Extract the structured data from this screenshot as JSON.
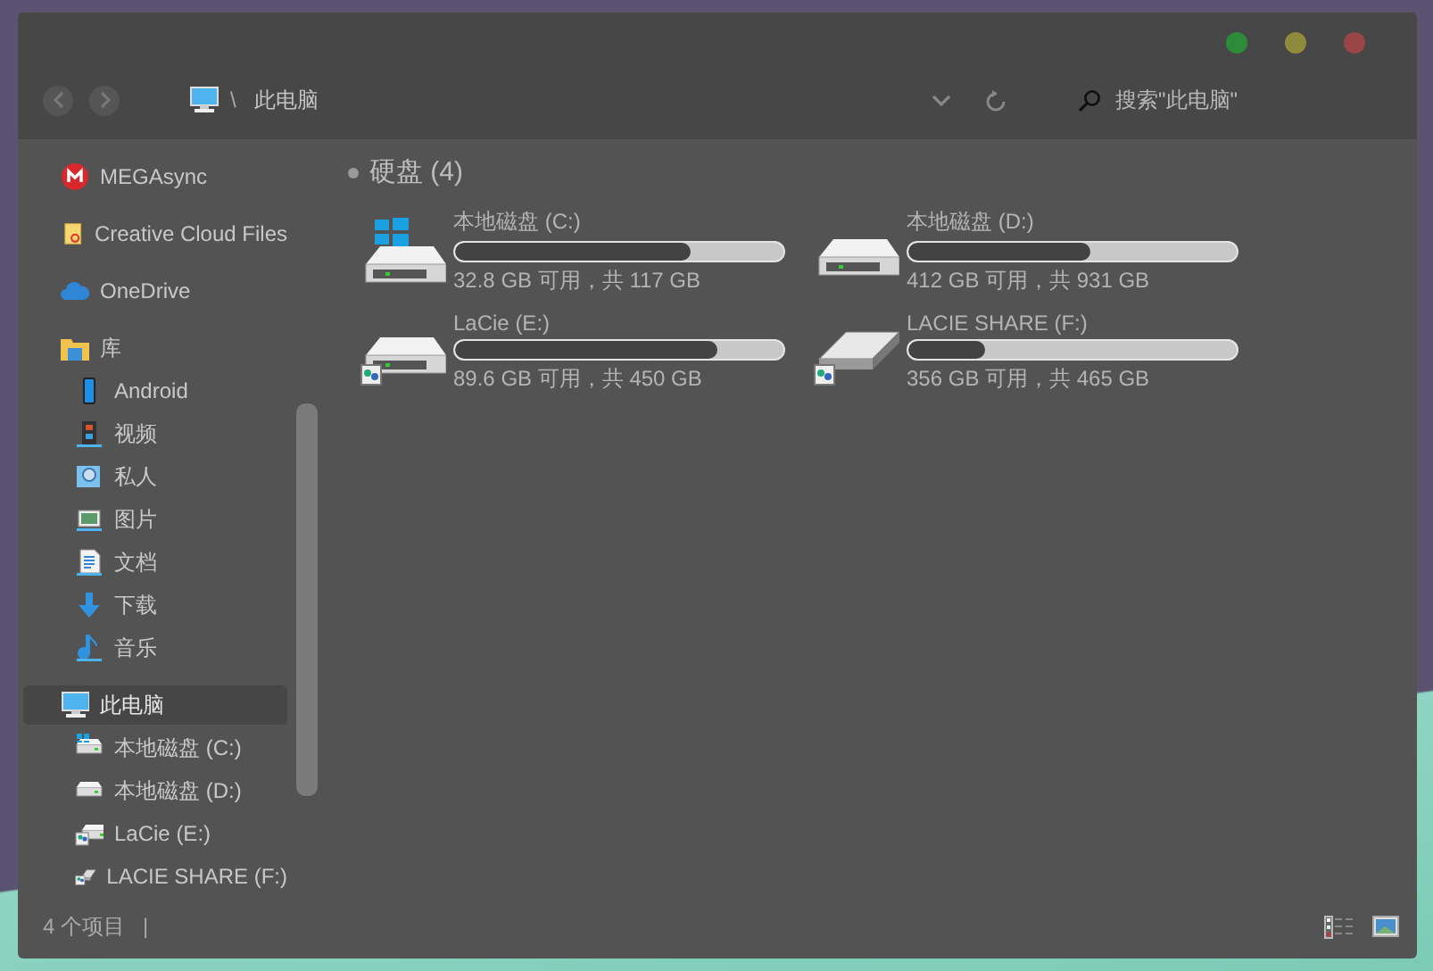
{
  "window": {
    "title_buttons": [
      {
        "color": "#2e8b3a"
      },
      {
        "color": "#8f8a3c"
      },
      {
        "color": "#9a4646"
      }
    ]
  },
  "address_bar": {
    "path": "此电脑",
    "separator": "\\"
  },
  "search": {
    "placeholder": "搜索\"此电脑\""
  },
  "sidebar": {
    "items": [
      {
        "label": "MEGAsync",
        "selected": false
      },
      {
        "label": "Creative Cloud Files",
        "selected": false
      },
      {
        "label": "OneDrive",
        "selected": false
      },
      {
        "label": "库",
        "selected": false,
        "children": [
          {
            "label": "Android",
            "selected": false
          },
          {
            "label": "视频",
            "selected": false
          },
          {
            "label": "私人",
            "selected": false
          },
          {
            "label": "图片",
            "selected": false
          },
          {
            "label": "文档",
            "selected": false
          },
          {
            "label": "下载",
            "selected": false
          },
          {
            "label": "音乐",
            "selected": false
          }
        ]
      },
      {
        "label": "此电脑",
        "selected": true,
        "children": [
          {
            "label": "本地磁盘 (C:)",
            "selected": false
          },
          {
            "label": "本地磁盘 (D:)",
            "selected": false
          },
          {
            "label": "LaCie (E:)",
            "selected": false
          },
          {
            "label": "LACIE SHARE (F:)",
            "selected": false
          }
        ]
      }
    ]
  },
  "group": {
    "title": "硬盘 (4)",
    "drives": [
      {
        "name": "本地磁盘 (C:)",
        "level": 0.72,
        "space": "32.8 GB 可用，共 117 GB"
      },
      {
        "name": "本地磁盘 (D:)",
        "level": 0.557,
        "space": "412 GB 可用，共 931 GB"
      },
      {
        "name": "LaCie (E:)",
        "level": 0.8,
        "space": "89.6 GB 可用，共 450 GB"
      },
      {
        "name": "LACIE SHARE (F:)",
        "level": 0.234,
        "space": "356 GB 可用，共 465 GB"
      }
    ]
  },
  "status_bar": {
    "count": "4 个项目",
    "separator": "|"
  }
}
